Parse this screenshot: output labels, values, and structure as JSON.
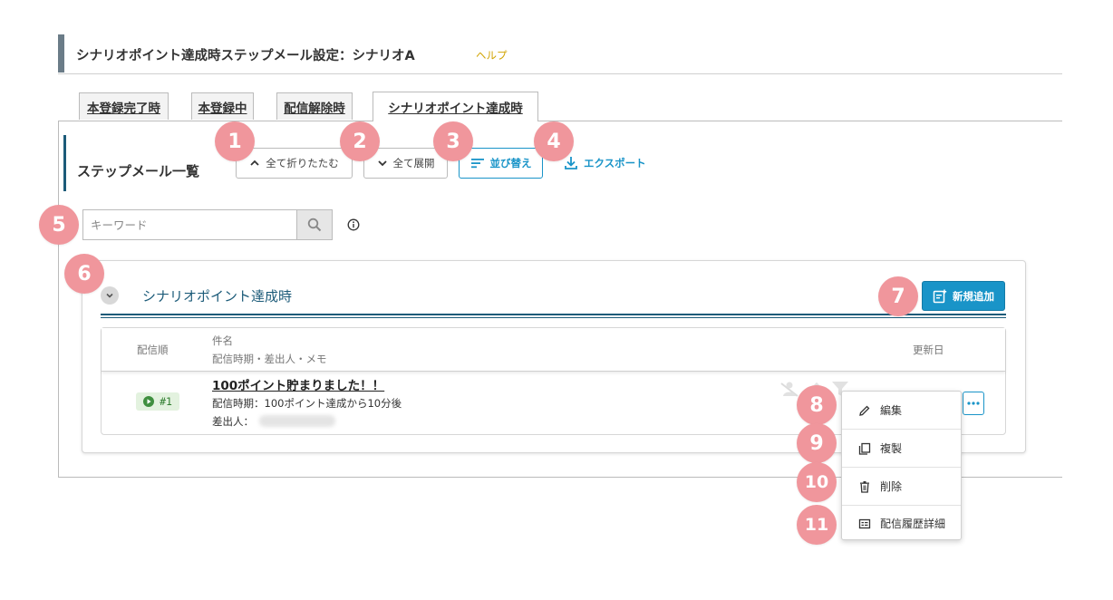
{
  "header": {
    "title": "シナリオポイント達成時ステップメール設定：シナリオA",
    "help_label": "ヘルプ"
  },
  "tabs": [
    {
      "label": "本登録完了時",
      "active": false
    },
    {
      "label": "本登録中",
      "active": false
    },
    {
      "label": "配信解除時",
      "active": false
    },
    {
      "label": "シナリオポイント達成時",
      "active": true
    }
  ],
  "list_section": {
    "title": "ステップメール一覧",
    "collapse_all_label": "全て折りたたむ",
    "expand_all_label": "全て展開",
    "sort_label": "並び替え",
    "export_label": "エクスポート"
  },
  "search": {
    "placeholder": "キーワード",
    "value": ""
  },
  "group": {
    "title": "シナリオポイント達成時",
    "add_button_label": "新規追加",
    "table": {
      "col_order": "配信順",
      "col_subject": "件名",
      "col_subject_sub": "配信時期・差出人・メモ",
      "col_updated": "更新日",
      "rows": [
        {
          "order": "#1",
          "status": "active",
          "subject": "100ポイント貯まりました！！",
          "timing": "配信時期：100ポイント達成から10分後",
          "sender_label": "差出人："
        }
      ]
    }
  },
  "row_menu": {
    "items": [
      {
        "label": "編集",
        "icon": "pencil-icon"
      },
      {
        "label": "複製",
        "icon": "copy-icon"
      },
      {
        "label": "削除",
        "icon": "trash-icon"
      },
      {
        "label": "配信履歴詳細",
        "icon": "history-icon"
      }
    ]
  },
  "annotation_markers": [
    "1",
    "2",
    "3",
    "4",
    "5",
    "6",
    "7",
    "8",
    "9",
    "10",
    "11"
  ],
  "colors": {
    "accent": "#1994c8",
    "section_navy": "#1c5b79",
    "header_bar": "#6b7c88",
    "help_link": "#d1a300",
    "marker": "#f0969c",
    "badge_bg": "#e3f2df",
    "badge_text": "#2f7d2f"
  }
}
